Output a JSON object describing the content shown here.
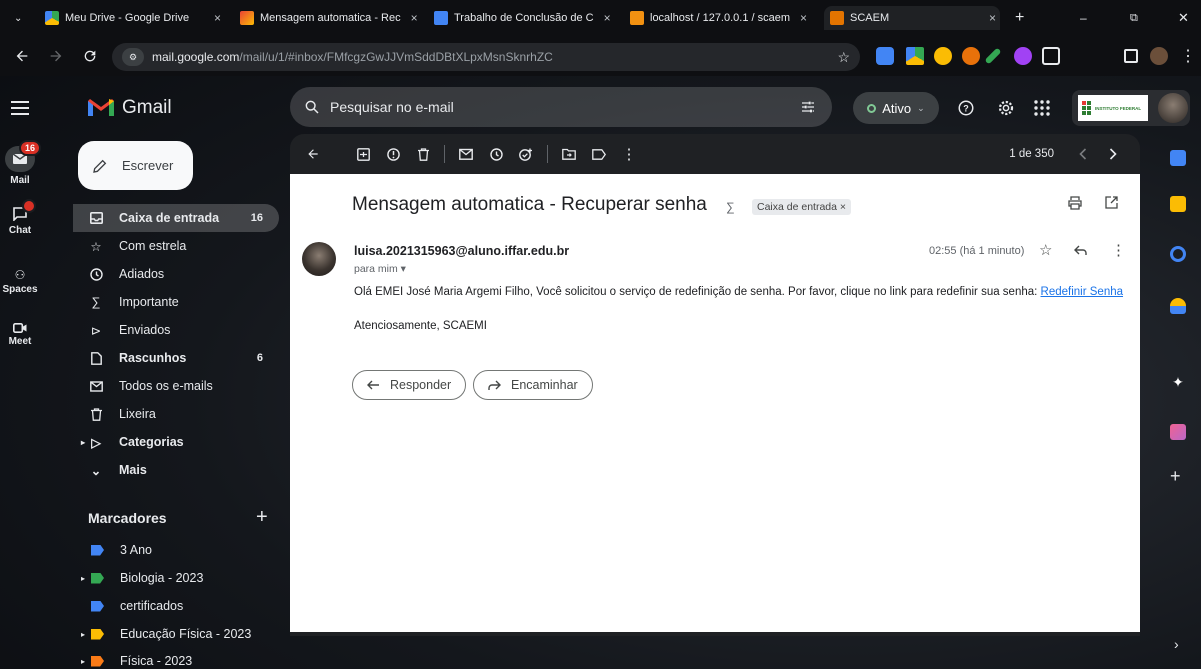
{
  "browser": {
    "tabs": [
      {
        "title": "Meu Drive - Google Drive",
        "close": "×"
      },
      {
        "title": "Mensagem automatica - Rec",
        "close": "×"
      },
      {
        "title": "Trabalho de Conclusão de C",
        "close": "×"
      },
      {
        "title": "localhost / 127.0.0.1 / scaem",
        "close": "×"
      },
      {
        "title": "SCAEM",
        "close": "×"
      }
    ],
    "new_tab": "+",
    "url_host": "mail.google.com",
    "url_path": "/mail/u/1/#inbox/FMfcgzGwJJVmSddDBtXLpxMsnSknrhZC"
  },
  "gmail": {
    "logo_text": "Gmail",
    "search_placeholder": "Pesquisar no e-mail",
    "status_label": "Ativo",
    "org_logo_text": "INSTITUTO FEDERAL"
  },
  "rail": [
    {
      "label": "Mail",
      "badge": "16"
    },
    {
      "label": "Chat",
      "badge": ""
    },
    {
      "label": "Spaces"
    },
    {
      "label": "Meet"
    }
  ],
  "sidebar": {
    "compose_label": "Escrever",
    "items": [
      {
        "label": "Caixa de entrada",
        "count": "16"
      },
      {
        "label": "Com estrela",
        "count": ""
      },
      {
        "label": "Adiados",
        "count": ""
      },
      {
        "label": "Importante",
        "count": ""
      },
      {
        "label": "Enviados",
        "count": ""
      },
      {
        "label": "Rascunhos",
        "count": "6"
      },
      {
        "label": "Todos os e-mails",
        "count": ""
      },
      {
        "label": "Lixeira",
        "count": ""
      },
      {
        "label": "Categorias",
        "count": ""
      },
      {
        "label": "Mais",
        "count": ""
      }
    ],
    "labels_title": "Marcadores",
    "labels_add": "+",
    "labels": [
      {
        "name": "3 Ano",
        "color": "#4285f4"
      },
      {
        "name": "Biologia - 2023",
        "color": "#34a853"
      },
      {
        "name": "certificados",
        "color": "#4285f4"
      },
      {
        "name": "Educação Física - 2023",
        "color": "#fbbc04"
      },
      {
        "name": "Física - 2023",
        "color": "#fa7b17"
      }
    ]
  },
  "toolbar": {
    "pagination": "1 de 350"
  },
  "email": {
    "subject": "Mensagem automatica - Recuperar senha",
    "label_chip": "Caixa de entrada ×",
    "sender": "luisa.2021315963@aluno.iffar.edu.br",
    "recipient": "para mim ▾",
    "time": "02:55 (há 1 minuto)",
    "body_text": "Olá EMEI José Maria Argemi Filho, Você solicitou o serviço de redefinição de senha. Por favor, clique no link para redefinir sua senha: ",
    "body_link": "Redefinir Senha",
    "signature": "Atenciosamente, SCAEMI",
    "reply_label": "Responder",
    "forward_label": "Encaminhar"
  },
  "colors": {
    "accent_blue": "#1a73e8",
    "badge_red": "#d93025",
    "status_green": "#81c995"
  }
}
